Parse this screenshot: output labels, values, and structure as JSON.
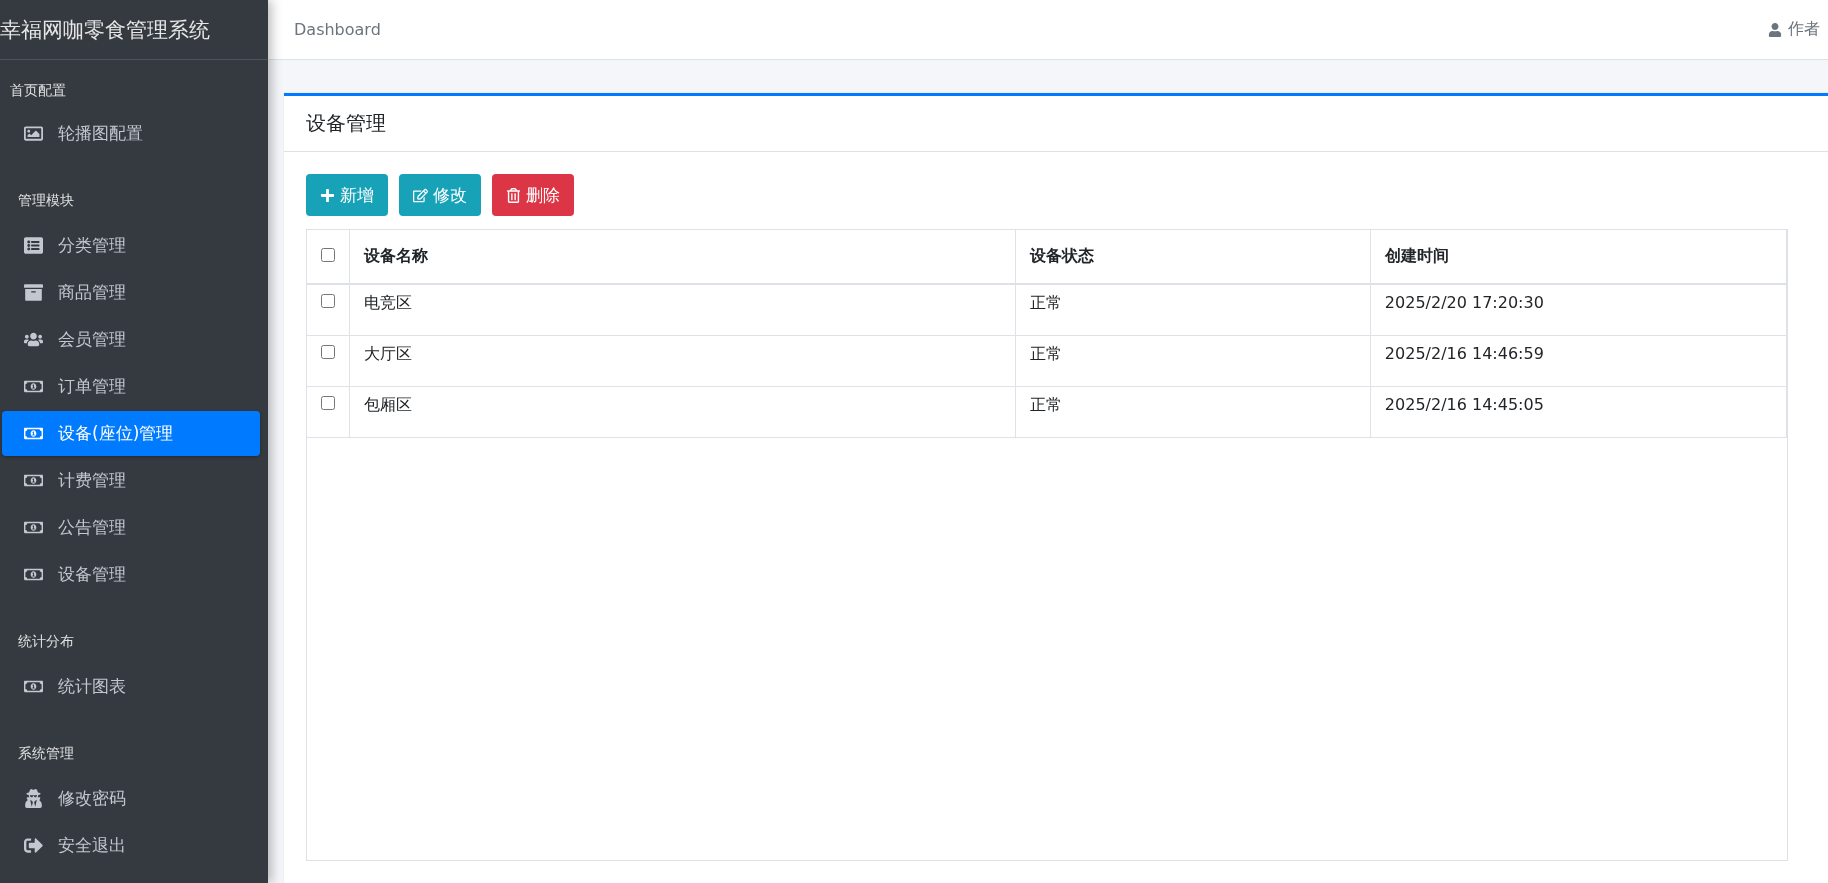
{
  "sidebar": {
    "brand": "幸福网咖零食管理系统",
    "groups": [
      {
        "label": "首页配置",
        "items": [
          {
            "label": "轮播图配置",
            "selected": false
          }
        ]
      },
      {
        "label": "管理模块",
        "items": [
          {
            "label": "分类管理",
            "selected": false
          },
          {
            "label": "商品管理",
            "selected": false
          },
          {
            "label": "会员管理",
            "selected": false
          },
          {
            "label": "订单管理",
            "selected": false
          },
          {
            "label": "设备(座位)管理",
            "selected": true
          },
          {
            "label": "计费管理",
            "selected": false
          },
          {
            "label": "公告管理",
            "selected": false
          },
          {
            "label": "设备管理",
            "selected": false
          }
        ]
      },
      {
        "label": "统计分布",
        "items": [
          {
            "label": "统计图表",
            "selected": false
          }
        ]
      },
      {
        "label": "系统管理",
        "items": [
          {
            "label": "修改密码",
            "selected": false
          },
          {
            "label": "安全退出",
            "selected": false
          }
        ]
      }
    ]
  },
  "header": {
    "breadcrumb": "Dashboard",
    "user": "作者"
  },
  "card": {
    "title": "设备管理",
    "buttons": [
      {
        "label": "新增",
        "kind": "add"
      },
      {
        "label": "修改",
        "kind": "edit"
      },
      {
        "label": "删除",
        "kind": "delete"
      }
    ],
    "table": {
      "all_checked": false,
      "columns": [
        "设备名称",
        "设备状态",
        "创建时间"
      ],
      "rows": [
        {
          "checked": false,
          "cells": [
            "电竞区",
            "正常",
            "2025/2/20 17:20:30"
          ]
        },
        {
          "checked": false,
          "cells": [
            "大厅区",
            "正常",
            "2025/2/16 14:46:59"
          ]
        },
        {
          "checked": false,
          "cells": [
            "包厢区",
            "正常",
            "2025/2/16 14:45:05"
          ]
        }
      ]
    }
  }
}
